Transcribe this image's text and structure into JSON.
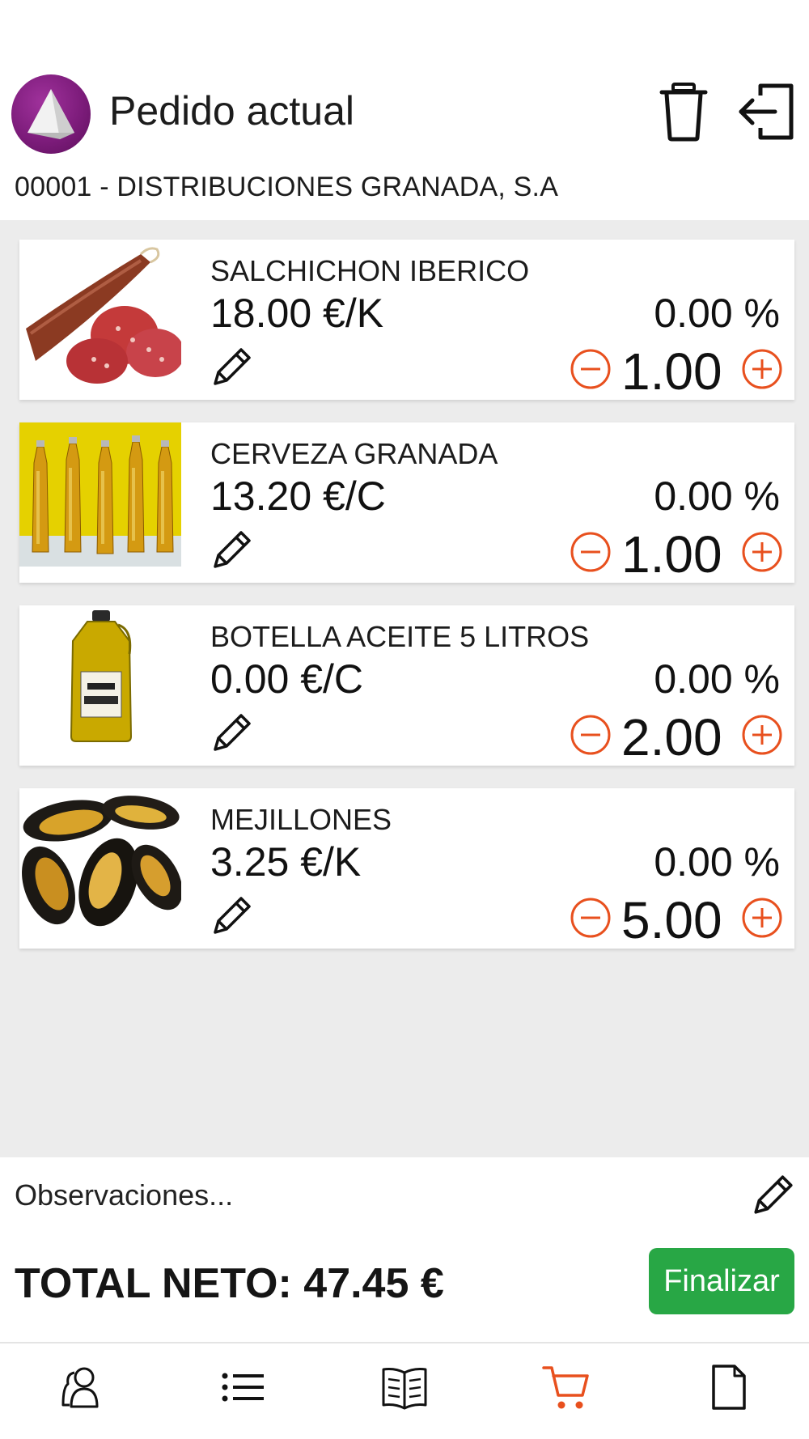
{
  "header": {
    "title": "Pedido actual",
    "client": "00001 - DISTRIBUCIONES GRANADA, S.A"
  },
  "products": [
    {
      "name": "SALCHICHON IBERICO",
      "price": "18.00 €/K",
      "discount": "0.00 %",
      "quantity": "1.00",
      "image": "salchichon-image"
    },
    {
      "name": "CERVEZA GRANADA",
      "price": "13.20 €/C",
      "discount": "0.00 %",
      "quantity": "1.00",
      "image": "beer-bottles-image"
    },
    {
      "name": "BOTELLA ACEITE 5 LITROS",
      "price": "0.00 €/C",
      "discount": "0.00 %",
      "quantity": "2.00",
      "image": "oil-bottle-image"
    },
    {
      "name": "MEJILLONES",
      "price": "3.25 €/K",
      "discount": "0.00 %",
      "quantity": "5.00",
      "image": "mussels-image"
    }
  ],
  "observations": {
    "placeholder": "Observaciones..."
  },
  "footer": {
    "total": "TOTAL NETO: 47.45 €",
    "finish_label": "Finalizar"
  },
  "nav": {
    "items": [
      "clients-icon",
      "list-icon",
      "catalog-icon",
      "cart-icon",
      "document-icon"
    ],
    "active": "cart-icon"
  },
  "colors": {
    "accent": "#e8501e",
    "finish_button": "#28a745",
    "logo": "#7d1c7b",
    "list_background": "#ececec"
  }
}
